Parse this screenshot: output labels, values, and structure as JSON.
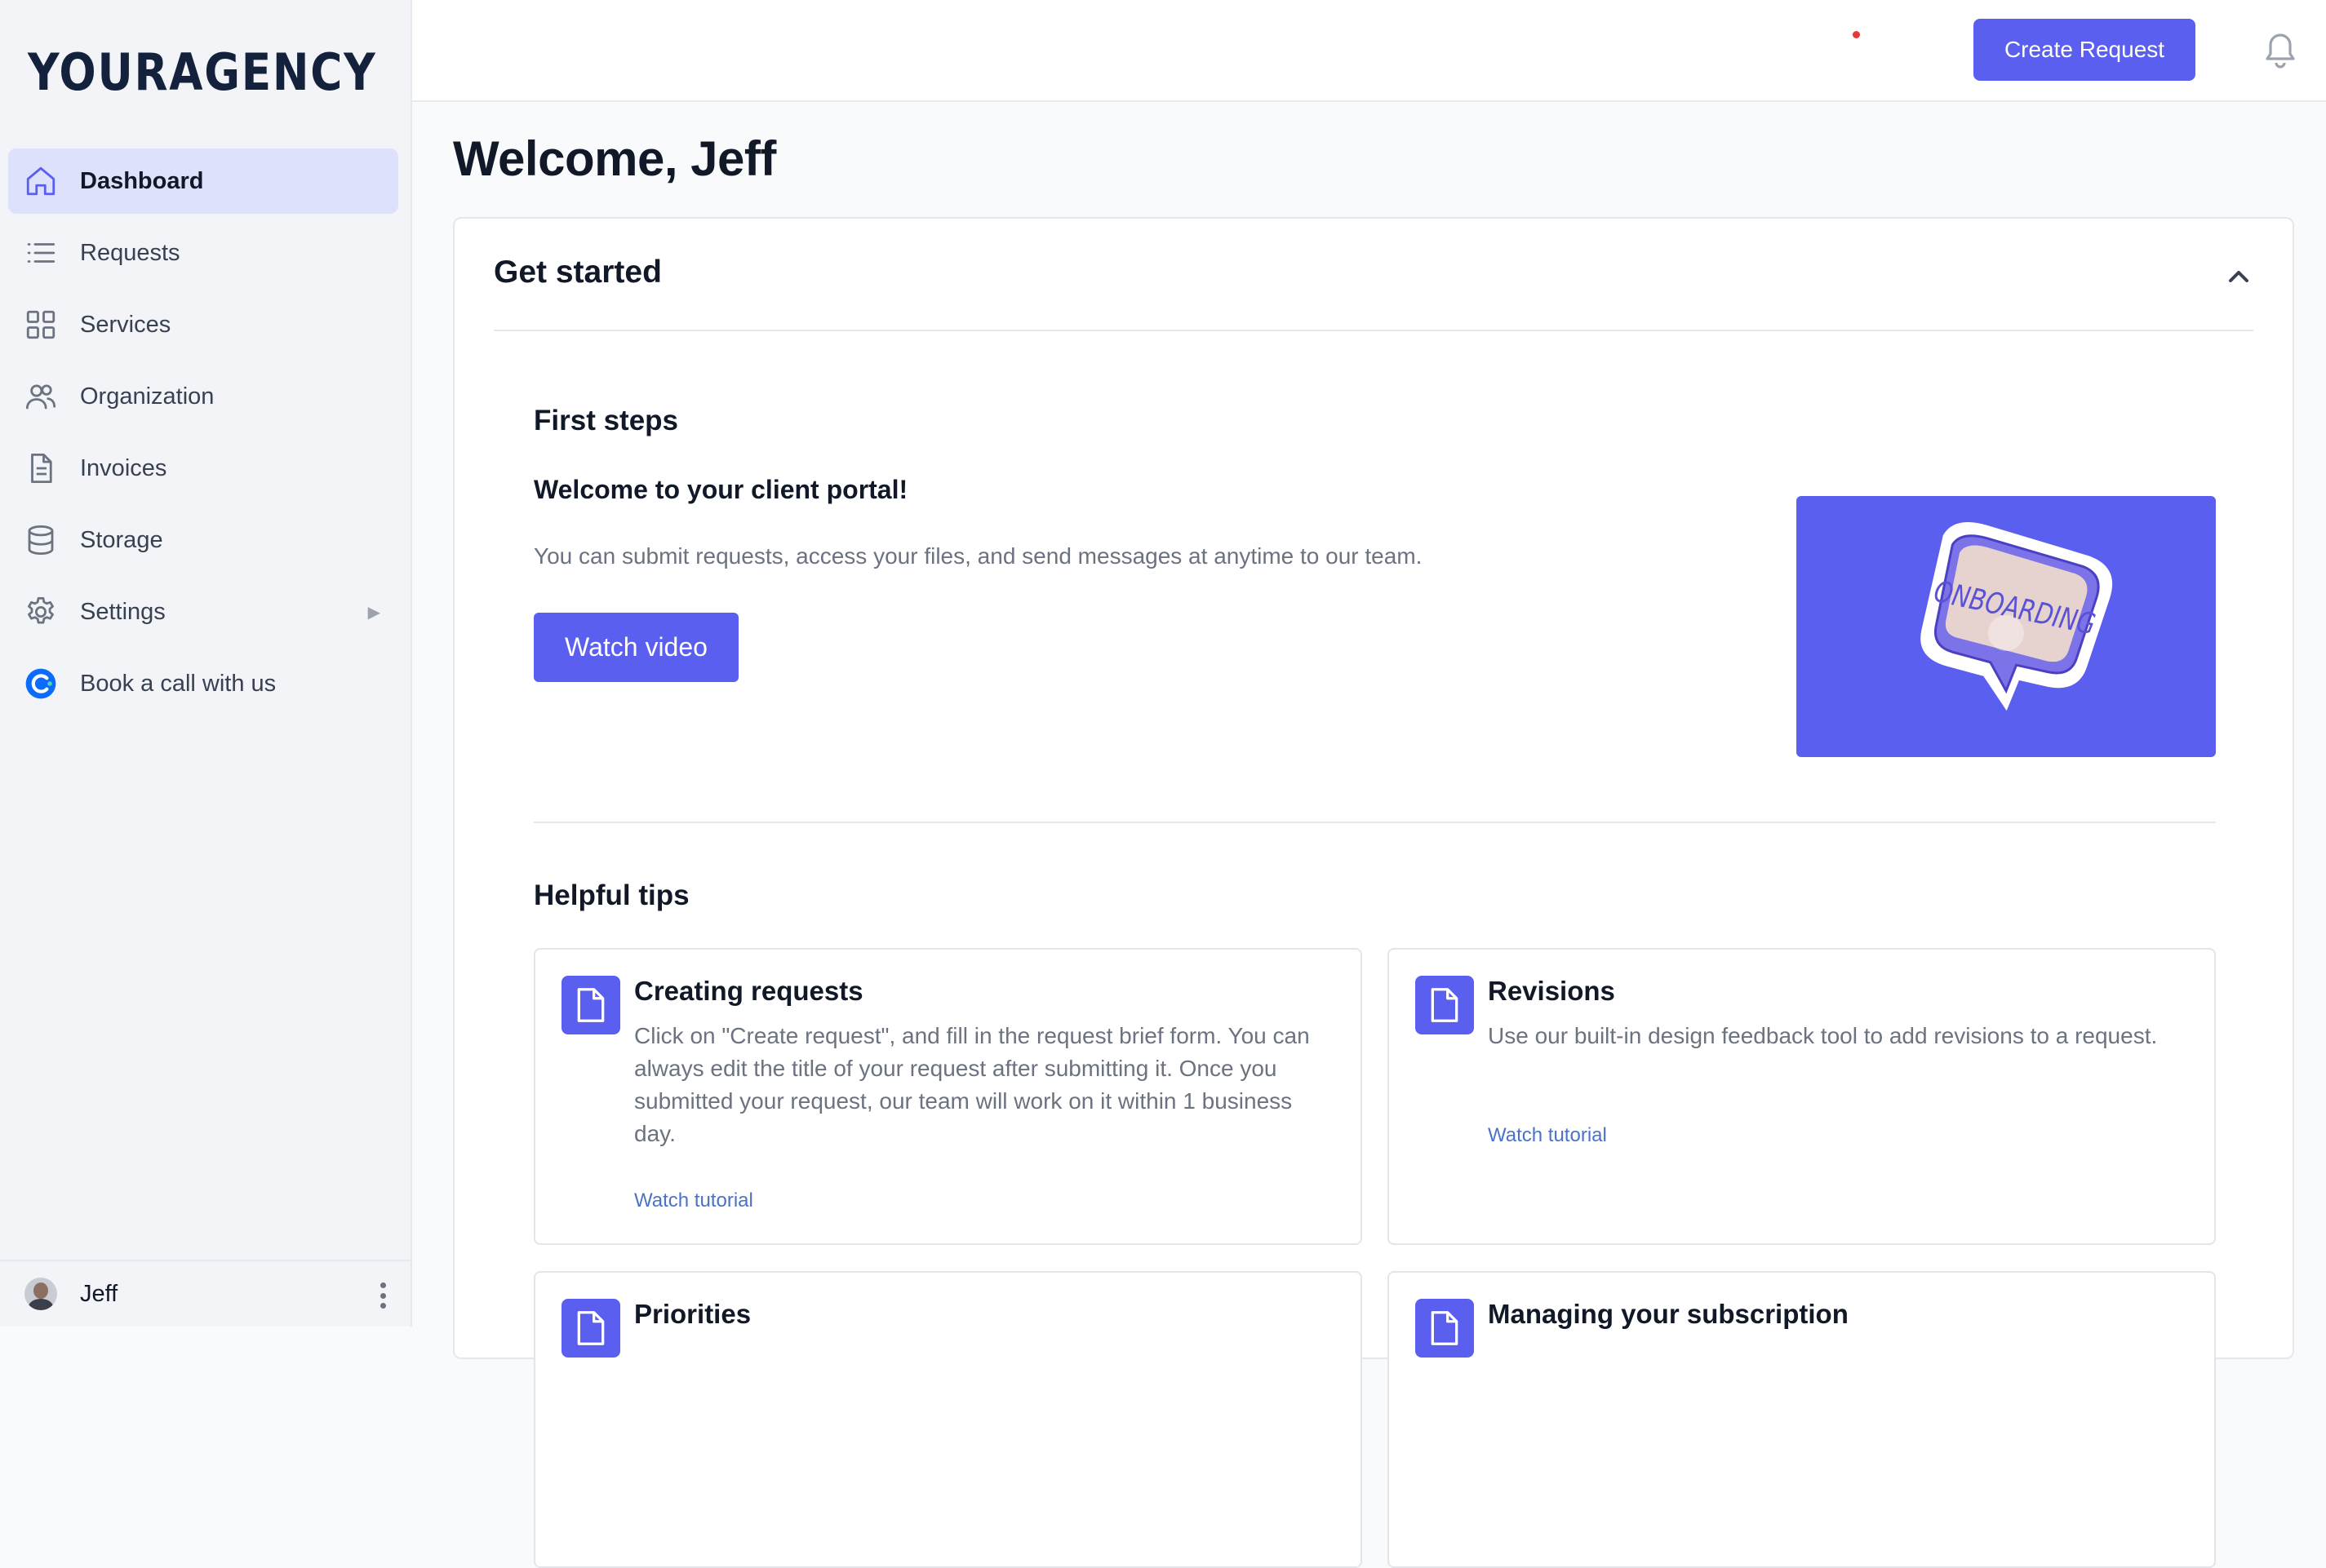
{
  "brand": {
    "logo": "YOURAGENCY",
    "accent": "#5b5ff0"
  },
  "sidebar": {
    "items": [
      {
        "label": "Dashboard",
        "icon": "home-icon",
        "active": true
      },
      {
        "label": "Requests",
        "icon": "list-icon"
      },
      {
        "label": "Services",
        "icon": "grid-icon"
      },
      {
        "label": "Organization",
        "icon": "users-icon"
      },
      {
        "label": "Invoices",
        "icon": "document-icon"
      },
      {
        "label": "Storage",
        "icon": "database-icon"
      },
      {
        "label": "Settings",
        "icon": "gear-icon",
        "has_submenu": true
      },
      {
        "label": "Book a call with us",
        "icon": "calendly-icon"
      }
    ],
    "user": {
      "name": "Jeff"
    }
  },
  "topbar": {
    "create_label": "Create Request",
    "has_notification": true
  },
  "main": {
    "welcome": "Welcome, Jeff",
    "get_started": {
      "title": "Get started",
      "first_steps": {
        "title": "First steps",
        "subtitle": "Welcome to your client portal!",
        "text": "You can submit requests, access your files, and send messages at anytime to our team.",
        "button": "Watch video",
        "thumbnail_text": "ONBOARDING"
      },
      "tips": {
        "title": "Helpful tips",
        "items": [
          {
            "title": "Creating requests",
            "text": "Click on \"Create request\", and fill in the request brief form. You can always edit the title of your request after submitting it. Once you submitted your request, our team will work on it within 1 business day.",
            "link": "Watch tutorial"
          },
          {
            "title": "Revisions",
            "text": "Use our built-in design feedback tool to add revisions to a request.",
            "link": "Watch tutorial"
          },
          {
            "title": "Priorities"
          },
          {
            "title": "Managing your subscription"
          }
        ]
      }
    }
  }
}
